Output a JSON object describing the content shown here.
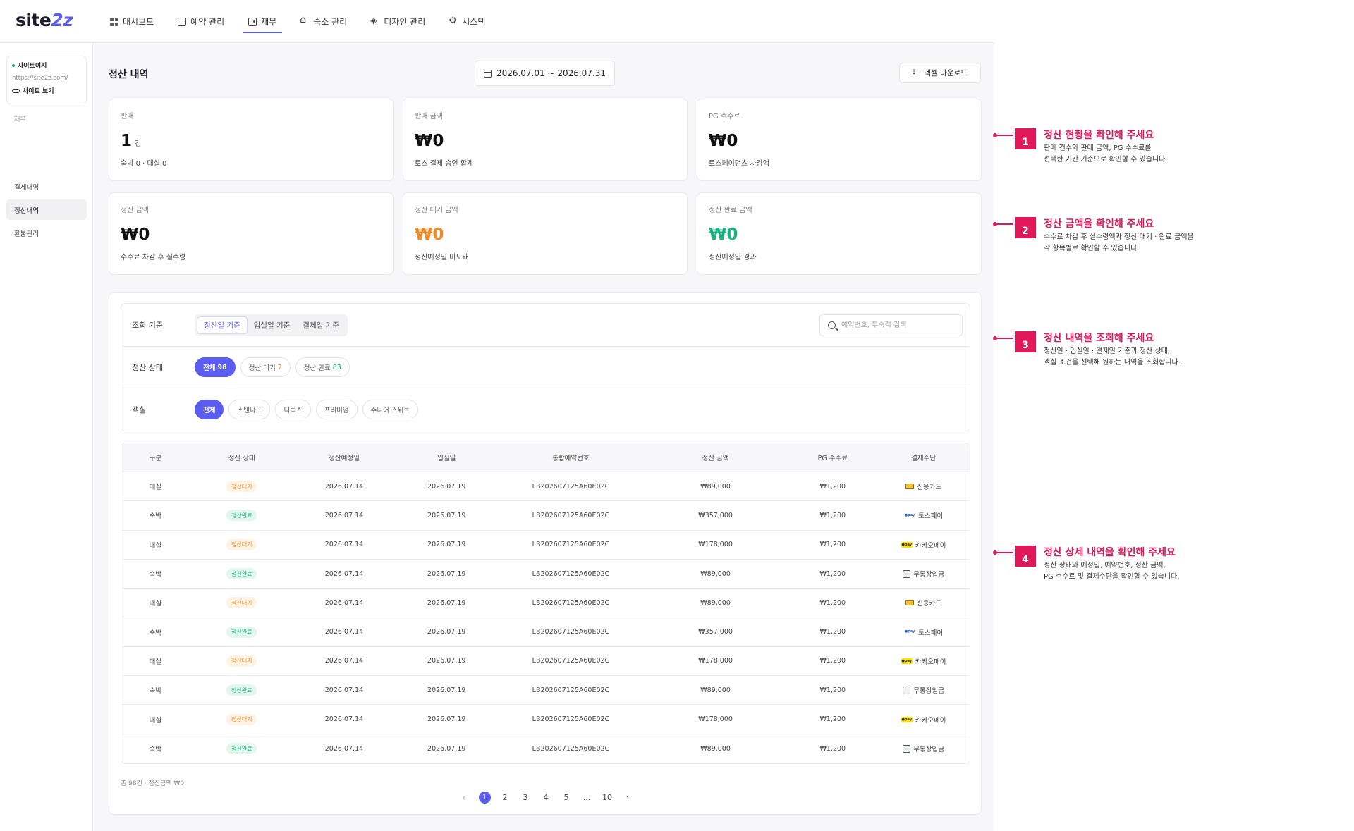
{
  "logo": {
    "main": "site",
    "accent": "2z"
  },
  "nav": [
    {
      "label": "대시보드",
      "icon": "dashboard-grid-icon",
      "active": false
    },
    {
      "label": "예약 관리",
      "icon": "calendar-icon",
      "active": false
    },
    {
      "label": "재무",
      "icon": "wallet-icon",
      "active": true
    },
    {
      "label": "숙소 관리",
      "icon": "home-icon",
      "active": false
    },
    {
      "label": "디자인 관리",
      "icon": "layers-icon",
      "active": false
    },
    {
      "label": "시스템",
      "icon": "gear-icon",
      "active": false
    }
  ],
  "sidebar": {
    "site_name": "사이트이지",
    "site_url": "https://site2z.com/",
    "site_view": "사이트 보기",
    "group": "재무",
    "items": [
      {
        "label": "결제내역",
        "active": false
      },
      {
        "label": "정산내역",
        "active": true
      },
      {
        "label": "환불관리",
        "active": false
      }
    ]
  },
  "header": {
    "title": "정산 내역",
    "date_range": "2026.07.01 ~ 2026.07.31",
    "excel_button": "엑셀 다운로드"
  },
  "stats": [
    {
      "label": "판매",
      "value": "1",
      "unit": "건",
      "sub": "숙박 0 · 대실 0",
      "color": "default"
    },
    {
      "label": "판매 금액",
      "value": "₩0",
      "unit": "",
      "sub": "토스 결제 승인 합계",
      "color": "default"
    },
    {
      "label": "PG 수수료",
      "value": "₩0",
      "unit": "",
      "sub": "토스페이먼츠 차감액",
      "color": "default"
    },
    {
      "label": "정산 금액",
      "value": "₩0",
      "unit": "",
      "sub": "수수료 차감 후 실수령",
      "color": "default"
    },
    {
      "label": "정산 대기 금액",
      "value": "₩0",
      "unit": "",
      "sub": "정산예정일 미도래",
      "color": "#f08a24"
    },
    {
      "label": "정산 완료 금액",
      "value": "₩0",
      "unit": "",
      "sub": "정산예정일 경과",
      "color": "#19b37e"
    }
  ],
  "filters": {
    "basis_label": "조회 기준",
    "basis_options": [
      "정산일 기준",
      "입실일 기준",
      "결제일 기준"
    ],
    "basis_active": 0,
    "search_placeholder": "예약번호, 투숙객 검색",
    "status_label": "정산 상태",
    "status_chips": [
      {
        "label": "전체",
        "count": "98",
        "active": true
      },
      {
        "label": "정산 대기",
        "count": "7",
        "active": false
      },
      {
        "label": "정산 완료",
        "count": "83",
        "active": false
      }
    ],
    "room_label": "객실",
    "room_chips": [
      "전체",
      "스탠다드",
      "디럭스",
      "프리미엄",
      "주니어 스위트"
    ],
    "room_active": 0
  },
  "table": {
    "headers": [
      "구분",
      "정산 상태",
      "정산예정일",
      "입실일",
      "통합예약번호",
      "정산 금액",
      "PG 수수료",
      "결제수단"
    ],
    "rows": [
      {
        "type": "대실",
        "status": "정산대기",
        "settle_date": "2026.07.14",
        "checkin": "2026.07.19",
        "reservation_no": "LB202607125A60E02C",
        "amount": "₩89,000",
        "pg_fee": "₩1,200",
        "method": "신용카드",
        "method_icon": "credit-card-icon"
      },
      {
        "type": "숙박",
        "status": "정산완료",
        "settle_date": "2026.07.14",
        "checkin": "2026.07.19",
        "reservation_no": "LB202607125A60E02C",
        "amount": "₩357,000",
        "pg_fee": "₩1,200",
        "method": "토스페이",
        "method_icon": "toss-pay-icon"
      },
      {
        "type": "대실",
        "status": "정산대기",
        "settle_date": "2026.07.14",
        "checkin": "2026.07.19",
        "reservation_no": "LB202607125A60E02C",
        "amount": "₩178,000",
        "pg_fee": "₩1,200",
        "method": "카카오페이",
        "method_icon": "kakao-pay-icon"
      },
      {
        "type": "숙박",
        "status": "정산완료",
        "settle_date": "2026.07.14",
        "checkin": "2026.07.19",
        "reservation_no": "LB202607125A60E02C",
        "amount": "₩89,000",
        "pg_fee": "₩1,200",
        "method": "무통장입금",
        "method_icon": "bank-transfer-icon"
      },
      {
        "type": "대실",
        "status": "정산대기",
        "settle_date": "2026.07.14",
        "checkin": "2026.07.19",
        "reservation_no": "LB202607125A60E02C",
        "amount": "₩89,000",
        "pg_fee": "₩1,200",
        "method": "신용카드",
        "method_icon": "credit-card-icon"
      },
      {
        "type": "숙박",
        "status": "정산완료",
        "settle_date": "2026.07.14",
        "checkin": "2026.07.19",
        "reservation_no": "LB202607125A60E02C",
        "amount": "₩357,000",
        "pg_fee": "₩1,200",
        "method": "토스페이",
        "method_icon": "toss-pay-icon"
      },
      {
        "type": "대실",
        "status": "정산대기",
        "settle_date": "2026.07.14",
        "checkin": "2026.07.19",
        "reservation_no": "LB202607125A60E02C",
        "amount": "₩178,000",
        "pg_fee": "₩1,200",
        "method": "카카오페이",
        "method_icon": "kakao-pay-icon"
      },
      {
        "type": "숙박",
        "status": "정산완료",
        "settle_date": "2026.07.14",
        "checkin": "2026.07.19",
        "reservation_no": "LB202607125A60E02C",
        "amount": "₩89,000",
        "pg_fee": "₩1,200",
        "method": "무통장입금",
        "method_icon": "bank-transfer-icon"
      },
      {
        "type": "대실",
        "status": "정산대기",
        "settle_date": "2026.07.14",
        "checkin": "2026.07.19",
        "reservation_no": "LB202607125A60E02C",
        "amount": "₩178,000",
        "pg_fee": "₩1,200",
        "method": "카카오페이",
        "method_icon": "kakao-pay-icon"
      },
      {
        "type": "숙박",
        "status": "정산완료",
        "settle_date": "2026.07.14",
        "checkin": "2026.07.19",
        "reservation_no": "LB202607125A60E02C",
        "amount": "₩89,000",
        "pg_fee": "₩1,200",
        "method": "무통장입금",
        "method_icon": "bank-transfer-icon"
      }
    ]
  },
  "summary": "총 98건 · 정산금액 ₩0",
  "pagination": {
    "pages": [
      "1",
      "2",
      "3",
      "4",
      "5",
      "...",
      "10"
    ],
    "active": "1"
  },
  "annotations": [
    {
      "num": "1",
      "title": "정산 현황을 확인해 주세요",
      "lines": [
        "판매 건수와 판매 금액, PG 수수료를",
        "선택한 기간 기준으로 확인할 수 있습니다."
      ]
    },
    {
      "num": "2",
      "title": "정산 금액을 확인해 주세요",
      "lines": [
        "수수료 차감 후 실수령액과 정산 대기 · 완료 금액을",
        "각 항목별로 확인할 수 있습니다."
      ]
    },
    {
      "num": "3",
      "title": "정산 내역을 조회해 주세요",
      "lines": [
        "정산일 · 입실일 · 결제일 기준과 정산 상태,",
        "객실 조건을 선택해 원하는 내역을 조회합니다."
      ]
    },
    {
      "num": "4",
      "title": "정산 상세 내역을 확인해 주세요",
      "lines": [
        "정산 상태와 예정일, 예약번호, 정산 금액,",
        "PG 수수료 및 결제수단을 확인할 수 있습니다."
      ]
    }
  ],
  "colors": {
    "accent": "#5b5cf0",
    "pending": "#f08a24",
    "done": "#19b37e",
    "annotation": "#e0195a"
  }
}
